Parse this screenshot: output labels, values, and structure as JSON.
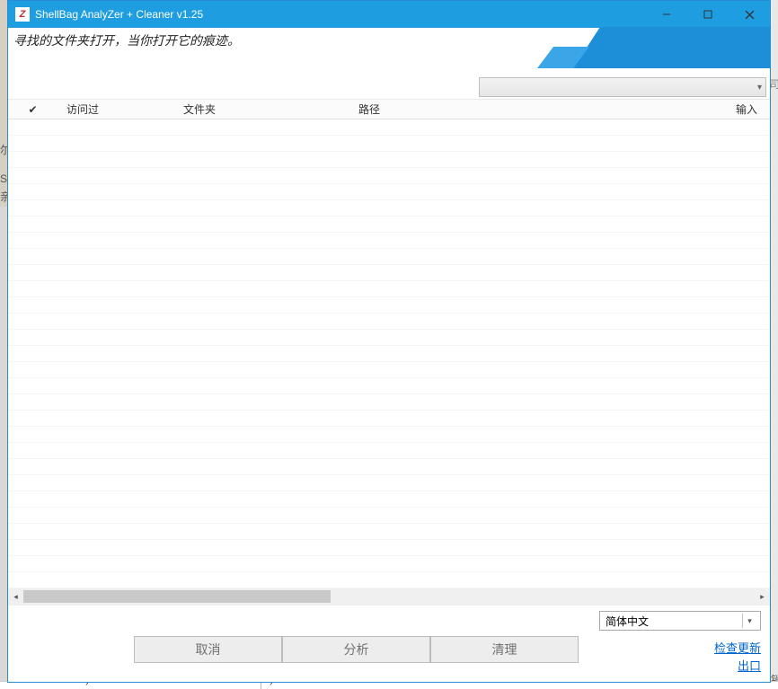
{
  "window": {
    "title": "ShellBag  AnalyZer + Cleaner v1.25",
    "app_icon_text": "Z"
  },
  "banner": {
    "description": "寻找的文件夹打开，当你打开它的痕迹。"
  },
  "columns": {
    "checkbox": "✔",
    "accessed": "访问过",
    "folder": "文件夹",
    "path": "路径",
    "input": "输入"
  },
  "footer": {
    "language_options": [
      "简体中文"
    ],
    "language_selected": "简体中文",
    "buttons": {
      "cancel": "取消",
      "analyze": "分析",
      "clean": "清理"
    },
    "links": {
      "check_update": "检查更新",
      "exit": "出口"
    }
  },
  "bg_chars": [
    "尔",
    "S",
    "亲"
  ]
}
